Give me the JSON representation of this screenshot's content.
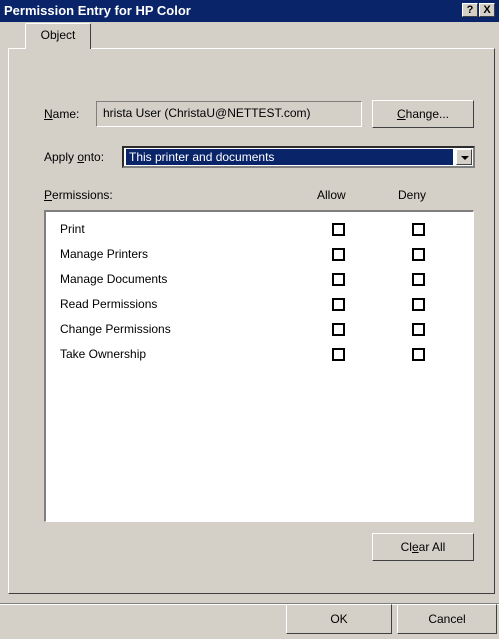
{
  "window": {
    "title": "Permission Entry for HP Color",
    "help_label": "?",
    "close_label": "X"
  },
  "tabs": [
    {
      "label": "Object"
    }
  ],
  "name": {
    "label_prefix": "",
    "label_accel": "N",
    "label_rest": "ame:",
    "value": "hrista User (ChristaU@NETTEST.com)",
    "change_accel": "C",
    "change_rest": "hange..."
  },
  "apply_onto": {
    "label_prefix": "Apply ",
    "label_accel": "o",
    "label_rest": "nto:",
    "selected": "This printer and documents"
  },
  "permissions": {
    "label_accel": "P",
    "label_rest": "ermissions:",
    "allow_header": "Allow",
    "deny_header": "Deny",
    "rows": [
      {
        "label": "Print",
        "allow": false,
        "deny": false
      },
      {
        "label": "Manage Printers",
        "allow": false,
        "deny": false
      },
      {
        "label": "Manage Documents",
        "allow": false,
        "deny": false
      },
      {
        "label": "Read Permissions",
        "allow": false,
        "deny": false
      },
      {
        "label": "Change Permissions",
        "allow": false,
        "deny": false
      },
      {
        "label": "Take Ownership",
        "allow": false,
        "deny": false
      }
    ]
  },
  "clear_all": {
    "prefix": "Cl",
    "accel": "e",
    "rest": "ar All"
  },
  "buttons": {
    "ok": "OK",
    "cancel": "Cancel"
  }
}
